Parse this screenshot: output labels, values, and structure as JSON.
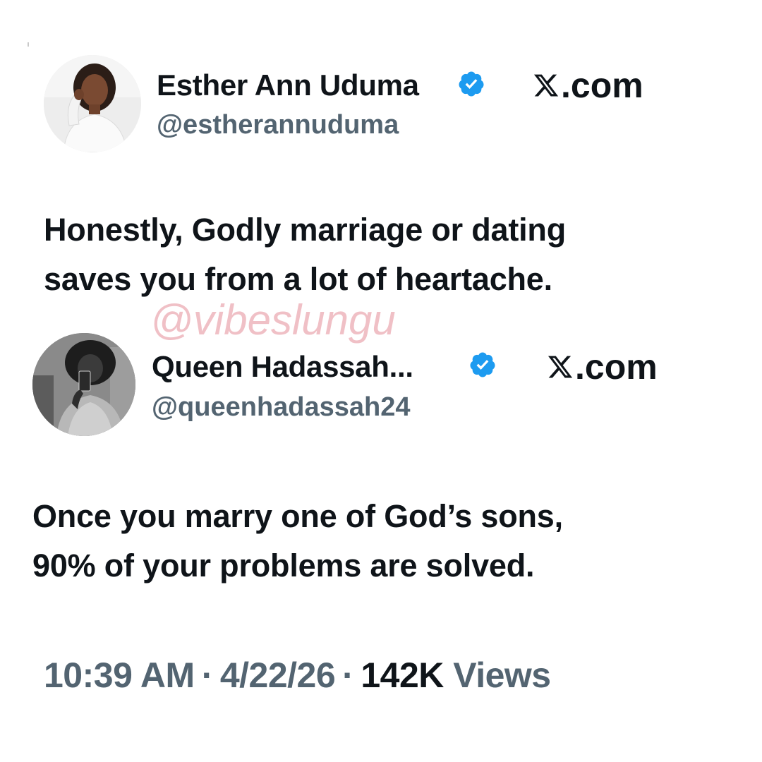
{
  "tweet_1": {
    "display_name": "Esther Ann Uduma",
    "handle": "@estherannuduma",
    "site": ".com",
    "text_line_1": "Honestly, Godly marriage or dating",
    "text_line_2": "saves you from a lot of heartache."
  },
  "watermark": "@vibeslungu",
  "tweet_2": {
    "display_name": "Queen Hadassah...",
    "handle": "@queenhadassah24",
    "site": ".com",
    "text_line_1": "Once you marry one of God’s sons,",
    "text_line_2": "90% of your problems are solved."
  },
  "meta": {
    "time": "10:39 AM",
    "separator": "·",
    "date": "4/22/26",
    "views_count": "142K",
    "views_label": "Views"
  },
  "colors": {
    "verified_blue": "#1d9bf0",
    "handle_gray": "#536471",
    "text": "#0f1419",
    "watermark_pink": "#f0c0c6"
  },
  "icons": {
    "verified": "verified-badge-icon",
    "x_logo": "x-logo-icon"
  }
}
